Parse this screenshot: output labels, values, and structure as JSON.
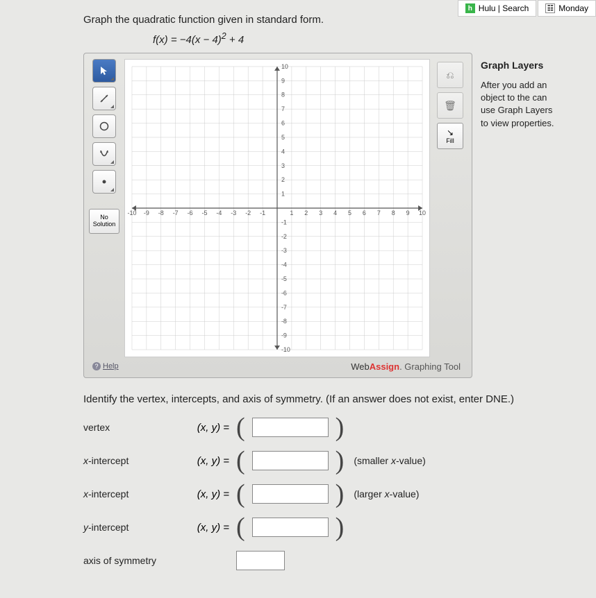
{
  "tabs": {
    "hulu": "Hulu | Search",
    "monday": "Monday"
  },
  "prompt": "Graph the quadratic function given in standard form.",
  "formula": "f(x) = −4(x − 4)² + 4",
  "toolbar": {
    "no_solution_l1": "No",
    "no_solution_l2": "Solution",
    "fill": "Fill",
    "help": "Help"
  },
  "brand": {
    "web": "Web",
    "assign": "Assign",
    "suffix": ". Graphing Tool"
  },
  "layers": {
    "title": "Graph Layers",
    "text": "After you add an object to the can use Graph Layers to view properties."
  },
  "q": {
    "instr": "Identify the vertex, intercepts, and axis of symmetry. (If an answer does not exist, enter DNE.)",
    "vertex": "vertex",
    "xint1": "x-intercept",
    "xint2": "x-intercept",
    "yint": "y-intercept",
    "axis": "axis of symmetry",
    "eq": "(x, y)  =",
    "smaller": "(smaller x-value)",
    "larger": "(larger x-value)"
  },
  "chart_data": {
    "type": "scatter",
    "xlim": [
      -10,
      10
    ],
    "ylim": [
      -10,
      10
    ],
    "xticks": [
      -10,
      -9,
      -8,
      -7,
      -6,
      -5,
      -4,
      -3,
      -2,
      -1,
      1,
      2,
      3,
      4,
      5,
      6,
      7,
      8,
      9,
      10
    ],
    "yticks": [
      -10,
      -9,
      -8,
      -7,
      -6,
      -5,
      -4,
      -3,
      -2,
      -1,
      1,
      2,
      3,
      4,
      5,
      6,
      7,
      8,
      9,
      10
    ],
    "series": []
  }
}
